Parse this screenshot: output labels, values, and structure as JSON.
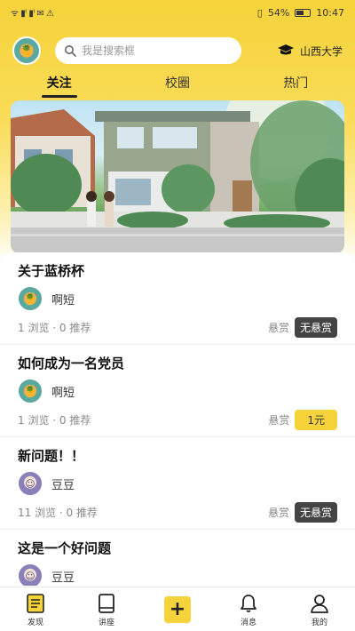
{
  "status_bar": {
    "left": "ᯤ ▮ᴵ ▮ᴵ ✉ ⚠",
    "battery_percent": "54%",
    "time": "10:47"
  },
  "header": {
    "search_placeholder": "我是搜索框",
    "school": "山西大学"
  },
  "tabs": [
    {
      "label": "关注",
      "active": true
    },
    {
      "label": "校圈",
      "active": false
    },
    {
      "label": "热门",
      "active": false
    }
  ],
  "feed": [
    {
      "title": "关于蓝桥杯",
      "author": "啊短",
      "stats": "1 浏览 · 0 推荐",
      "reward_label": "悬赏",
      "reward": "无悬赏",
      "reward_type": "none"
    },
    {
      "title": "如何成为一名党员",
      "author": "啊短",
      "stats": "1 浏览 · 0 推荐",
      "reward_label": "悬赏",
      "reward": "1元",
      "reward_type": "money"
    },
    {
      "title": "新问题！！",
      "author": "豆豆",
      "stats": "11 浏览 · 0 推荐",
      "reward_label": "悬赏",
      "reward": "无悬赏",
      "reward_type": "none"
    },
    {
      "title": "这是一个好问题",
      "author": "豆豆",
      "stats": "",
      "reward_label": "",
      "reward": "",
      "reward_type": "none"
    }
  ],
  "bottom_nav": [
    {
      "label": "发现",
      "icon": "document-icon"
    },
    {
      "label": "讲座",
      "icon": "book-icon"
    },
    {
      "label": "",
      "icon": "plus-icon"
    },
    {
      "label": "消息",
      "icon": "bell-icon"
    },
    {
      "label": "我的",
      "icon": "person-icon"
    }
  ],
  "colors": {
    "accent": "#f6d33a",
    "badge_dark": "#444444"
  }
}
